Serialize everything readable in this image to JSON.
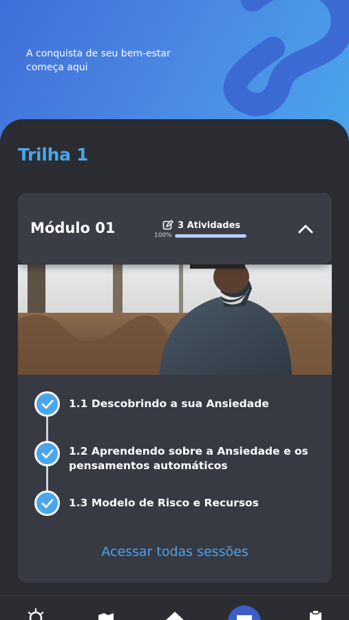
{
  "hero": {
    "tagline": "A conquista de seu bem-estar começa aqui",
    "colors": {
      "gradient_start": "#3f6fd9",
      "gradient_end": "#4aa6ec"
    }
  },
  "trail": {
    "title": "Trilha 1",
    "accent_color": "#4aa6ec"
  },
  "module": {
    "title": "Módulo 01",
    "activities_label": "3 Atividades",
    "progress_label": "100%",
    "progress_fraction": 1.0,
    "edit_icon": "edit-icon",
    "collapse_icon": "chevron-up-icon"
  },
  "lessons": [
    {
      "title": "1.1 Descobrindo a sua Ansiedade",
      "completed": true
    },
    {
      "title": "1.2 Aprendendo sobre a Ansiedade e os pensamentos automáticos",
      "completed": true
    },
    {
      "title": "1.3 Modelo de Risco e Recursos",
      "completed": true
    }
  ],
  "access_link": "Acessar todas sessões",
  "bottom_nav": [
    {
      "icon": "lightbulb-icon"
    },
    {
      "icon": "map-icon"
    },
    {
      "icon": "home-icon"
    },
    {
      "icon": "couch-icon",
      "active": true
    },
    {
      "icon": "clipboard-icon"
    }
  ]
}
